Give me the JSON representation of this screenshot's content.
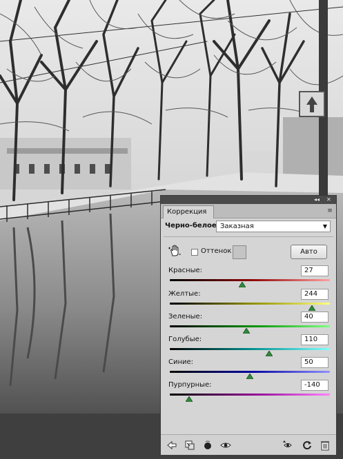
{
  "panel": {
    "tab_title": "Коррекция",
    "collapse_glyph": "◂◂",
    "close_glyph": "✕",
    "menu_glyph": "≡",
    "mode_label": "Черно-белое",
    "preset_value": "Заказная",
    "tint_label": "Оттенок",
    "tint_checked": false,
    "auto_label": "Авто"
  },
  "sliders": [
    {
      "label": "Красные:",
      "value": "27",
      "min": -200,
      "max": 300,
      "gradient": [
        "#000000",
        "#8c0000",
        "#ffa0a0"
      ]
    },
    {
      "label": "Желтые:",
      "value": "244",
      "min": -200,
      "max": 300,
      "gradient": [
        "#000000",
        "#8c8c00",
        "#ffff80"
      ]
    },
    {
      "label": "Зеленые:",
      "value": "40",
      "min": -200,
      "max": 300,
      "gradient": [
        "#000000",
        "#008c00",
        "#80ff80"
      ]
    },
    {
      "label": "Голубые:",
      "value": "110",
      "min": -200,
      "max": 300,
      "gradient": [
        "#000000",
        "#008c8c",
        "#80ffff"
      ]
    },
    {
      "label": "Синие:",
      "value": "50",
      "min": -200,
      "max": 300,
      "gradient": [
        "#000000",
        "#0000a0",
        "#9090ff"
      ]
    },
    {
      "label": "Пурпурные:",
      "value": "-140",
      "min": -200,
      "max": 300,
      "gradient": [
        "#000000",
        "#8c008c",
        "#ff80ff"
      ]
    }
  ],
  "bottom_icons": [
    "back-arrow-icon",
    "clip-to-layer-icon",
    "visibility-eye-icon",
    "eye-icon",
    "previous-state-icon",
    "reset-icon",
    "trash-icon"
  ],
  "colors": {
    "panel_bg": "#d5d5d5",
    "thumb": "#2f8a3a"
  }
}
